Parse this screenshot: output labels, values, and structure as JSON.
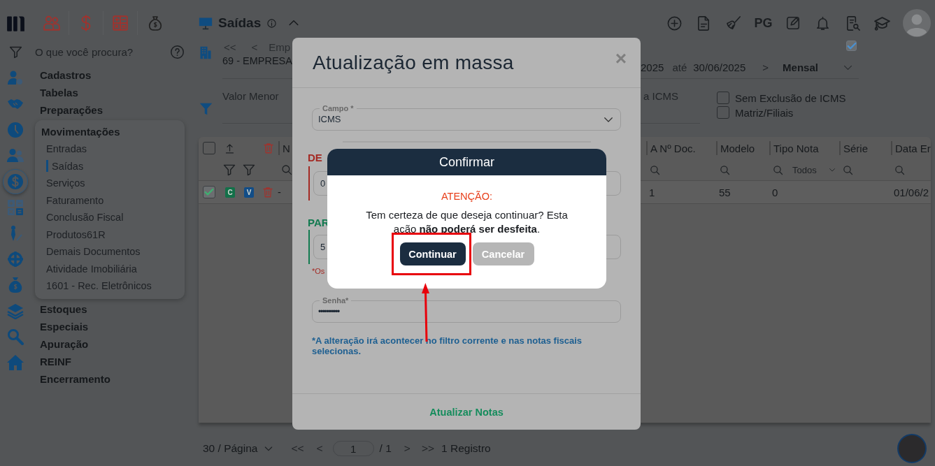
{
  "topbar": {
    "title": "Saídas",
    "pg_label": "PG"
  },
  "rail": [
    {
      "kind": "user-gear",
      "selected": false
    },
    {
      "kind": "handshake",
      "selected": false
    },
    {
      "kind": "clock",
      "selected": false
    },
    {
      "kind": "users",
      "selected": false
    },
    {
      "kind": "dollar",
      "selected": true
    },
    {
      "kind": "calculator",
      "selected": false
    },
    {
      "kind": "pen",
      "selected": false
    },
    {
      "kind": "crosshair",
      "selected": false
    },
    {
      "kind": "money-bag",
      "selected": false
    },
    {
      "kind": "layers",
      "selected": false
    },
    {
      "kind": "search",
      "selected": false
    },
    {
      "kind": "home",
      "selected": false
    }
  ],
  "search": {
    "placeholder": "O que você procura?"
  },
  "menu": [
    {
      "label": "Cadastros"
    },
    {
      "label": "Tabelas"
    },
    {
      "label": "Preparações"
    },
    {
      "label": "Movimentações",
      "expanded": true,
      "children": [
        {
          "label": "Entradas",
          "selected": false
        },
        {
          "label": "Saídas",
          "selected": true
        },
        {
          "label": "Serviços",
          "selected": false
        },
        {
          "label": "Faturamento",
          "selected": false
        },
        {
          "label": "Conclusão Fiscal",
          "selected": false
        },
        {
          "label": "Produtos61R",
          "selected": false
        },
        {
          "label": "Demais Documentos",
          "selected": false
        },
        {
          "label": "Atividade Imobiliária",
          "selected": false
        },
        {
          "label": "1601 - Rec. Eletrônicos",
          "selected": false
        }
      ]
    },
    {
      "label": "Estoques"
    },
    {
      "label": "Especiais"
    },
    {
      "label": "Apuração"
    },
    {
      "label": "REINF"
    },
    {
      "label": "Encerramento"
    }
  ],
  "period": {
    "first": "<<",
    "prev": "<",
    "company_label": "Emp",
    "company": "69 - EMPRESA",
    "start": "2025",
    "between": "até",
    "end": "30/06/2025",
    "next": ">",
    "mode": "Mensal",
    "flag_checked": true
  },
  "filters": {
    "left_placeholder": "Valor Menor",
    "right_placeholder": "a ICMS",
    "options": [
      {
        "label": "Sem Exclusão de ICMS",
        "checked": false
      },
      {
        "label": "Matriz/Filiais",
        "checked": false
      }
    ]
  },
  "table": {
    "all_checked": false,
    "first_header": "N",
    "columns": [
      {
        "label": "A Nº Doc."
      },
      {
        "label": "Modelo"
      },
      {
        "label": "Tipo Nota",
        "filter": "Todos"
      },
      {
        "label": "Série"
      },
      {
        "label": "Data Er"
      }
    ],
    "rows": [
      {
        "checked": true,
        "badges": [
          {
            "label": "C",
            "color": "#137049"
          },
          {
            "label": "V",
            "color": "#124d87"
          }
        ],
        "first_cell": "-",
        "cells": [
          "1",
          "55",
          "0",
          "",
          "01/06/2"
        ]
      }
    ]
  },
  "pagination": {
    "page_size": "30 / Página",
    "first": "<<",
    "prev": "<",
    "page": "1",
    "total": "/ 1",
    "next": ">",
    "last": ">>",
    "count": "1 Registro"
  },
  "modal": {
    "title": "Atualização em massa",
    "close": "×",
    "field": {
      "label": "Campo *",
      "value": "ICMS"
    },
    "from": {
      "label": "DE",
      "value": "0"
    },
    "to": {
      "label": "PAR",
      "value": "5"
    },
    "hint": "*Os",
    "password": {
      "label": "Senha*",
      "value": "•••••••••••"
    },
    "note": "*A alteração irá acontecer no filtro corrente e nas notas fiscais selecionas.",
    "submit": "Atualizar Notas"
  },
  "confirm": {
    "title": "Confirmar",
    "warning": "ATENÇÃO:",
    "message": "Tem certeza de que deseja continuar? Esta ação **não poderá ser desfeita**.",
    "buttons": [
      {
        "label": "Continuar",
        "kind": "primary",
        "highlighted": true
      },
      {
        "label": "Cancelar",
        "kind": "secondary",
        "highlighted": false
      }
    ]
  }
}
